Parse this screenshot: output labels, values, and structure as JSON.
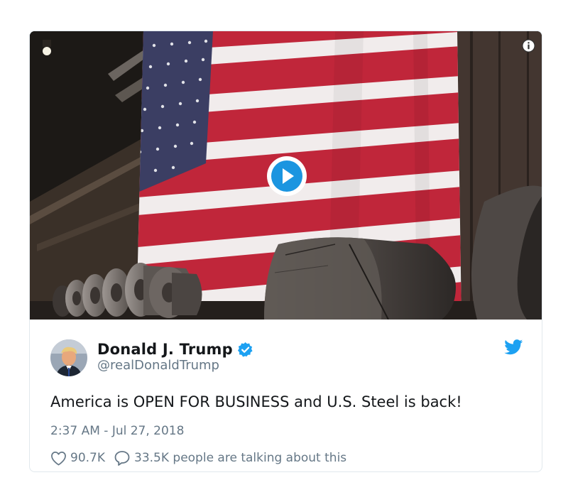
{
  "tweet": {
    "display_name": "Donald J. Trump",
    "handle": "@realDonaldTrump",
    "verified": true,
    "text": "America is OPEN FOR BUSINESS and U.S. Steel is back!",
    "timestamp": "2:37 AM - Jul 27, 2018",
    "likes": "90.7K",
    "talking": "33.5K people are talking about this"
  },
  "media": {
    "type": "video",
    "description_icon": "play-icon"
  },
  "icons": {
    "info": "info-icon",
    "play": "play-icon",
    "verified": "verified-badge-icon",
    "platform": "twitter-bird-icon",
    "like": "heart-icon",
    "reply": "comment-icon"
  },
  "colors": {
    "brand_blue": "#1da1f2",
    "text_primary": "#14171a",
    "text_secondary": "#657786",
    "play_blue": "#1b95e0"
  }
}
